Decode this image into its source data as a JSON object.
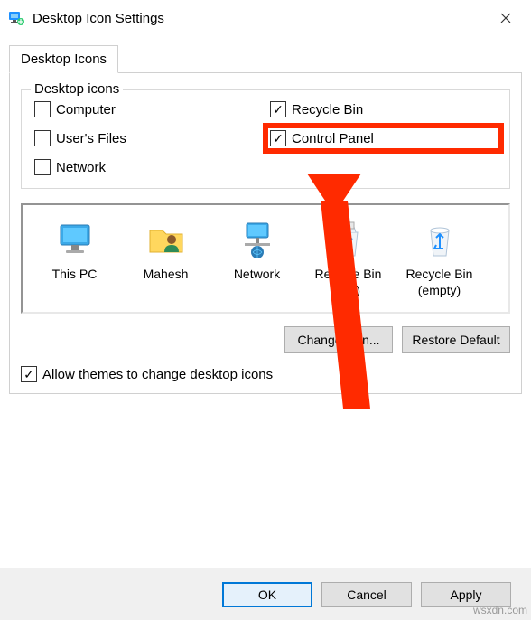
{
  "title": "Desktop Icon Settings",
  "tab_label": "Desktop Icons",
  "group_title": "Desktop icons",
  "checks": {
    "computer": {
      "label": "Computer",
      "checked": false
    },
    "users_files": {
      "label": "User's Files",
      "checked": false
    },
    "network": {
      "label": "Network",
      "checked": false
    },
    "recycle_bin": {
      "label": "Recycle Bin",
      "checked": true
    },
    "control_panel": {
      "label": "Control Panel",
      "checked": true
    }
  },
  "icons": {
    "this_pc": "This PC",
    "user_folder": "Mahesh",
    "network": "Network",
    "rb_full": "Recycle Bin (full)",
    "rb_empty": "Recycle Bin (empty)"
  },
  "buttons": {
    "change_icon": "Change Icon...",
    "restore_default": "Restore Default",
    "ok": "OK",
    "cancel": "Cancel",
    "apply": "Apply"
  },
  "allow_themes": {
    "label": "Allow themes to change desktop icons",
    "checked": true
  },
  "watermark": "wsxdn.com"
}
